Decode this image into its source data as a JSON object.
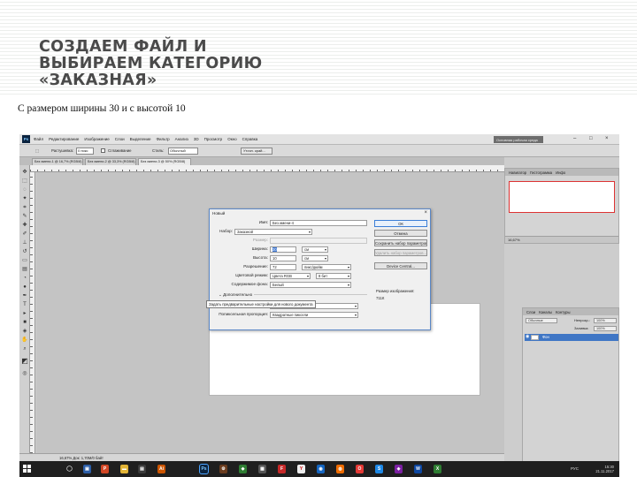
{
  "slide": {
    "title_lines": [
      "СОЗДАЕМ ФАЙЛ И",
      "ВЫБИРАЕМ КАТЕГОРИЮ",
      "«ЗАКАЗНАЯ»"
    ],
    "caption": "С размером ширины 30 и с высотой 10"
  },
  "app": {
    "logo": "Ps",
    "menu": [
      "Файл",
      "Редактирование",
      "Изображение",
      "Слои",
      "Выделение",
      "Фильтр",
      "Анализ",
      "3D",
      "Просмотр",
      "Окно",
      "Справка"
    ],
    "workspace": "Основная рабочая среда",
    "window_buttons": [
      "–",
      "□",
      "×"
    ],
    "options": {
      "feather_label": "Растушевка:",
      "feather_value": "0 пикс",
      "smooth_label": "Сглаживание",
      "style_label": "Стиль:",
      "style_value": "Обычный",
      "refine_label": "Уточн. край..."
    },
    "tabs": [
      "Без имени-1 @ 16,7% (RGB/8)",
      "Без имени-2 @ 33,3% (RGB/8)",
      "Без имени-3 @ 50% (RGB/8)"
    ],
    "status": "16,67%  Док: 1,70М/0 байт",
    "navigator": {
      "tabs": [
        "Навигатор",
        "Гистограмма",
        "Инфо"
      ],
      "zoom": "16,67%"
    },
    "layers": {
      "tabs": [
        "Слои",
        "Каналы",
        "Контуры"
      ],
      "blend": "Обычные",
      "opacity_label": "Непрозр.:",
      "opacity_value": "100%",
      "fill_label": "Заливка:",
      "fill_value": "100%",
      "layer_name": "Фон"
    }
  },
  "dialog": {
    "title": "Новый",
    "name_label": "Имя:",
    "name_value": "Без имени-4",
    "set_label": "Набор:",
    "set_value": "Заказной",
    "size_label": "Размер:",
    "width_label": "Ширина:",
    "width_value": "30",
    "width_unit": "см",
    "height_label": "Высота:",
    "height_value": "10",
    "height_unit": "см",
    "resolution_label": "Разрешение:",
    "resolution_value": "72",
    "resolution_unit": "пикс/дюйм",
    "color_mode_label": "Цветовой режим:",
    "color_mode_value": "Цвета RGB",
    "color_depth_value": "8 бит",
    "background_label": "Содержимое фона:",
    "background_value": "Белый",
    "advanced_label": "Дополнительно",
    "profile_label": "Цветовой профиль:",
    "profile_value": "Рабочее RGB: sRGB",
    "pixel_aspect_label": "Попиксельная пропорция:",
    "pixel_aspect_value": "Квадратные пиксели",
    "buttons": [
      "ОК",
      "Отмена",
      "Сохранить набор параметров...",
      "Удалить набор параметров...",
      "Device Central..."
    ],
    "image_size_label": "Размер изображения:",
    "image_size_value": "711К",
    "tooltip": "Задать предварительные настройки для нового документа"
  },
  "taskbar": {
    "lang": "РУС",
    "time": "15:30",
    "date": "21.11.2017"
  },
  "colors": {
    "accent": "#3f78d2",
    "dialog_border": "#5b87c6",
    "taskbar": "#1f1f1f",
    "title_text": "#4a4a4a"
  }
}
